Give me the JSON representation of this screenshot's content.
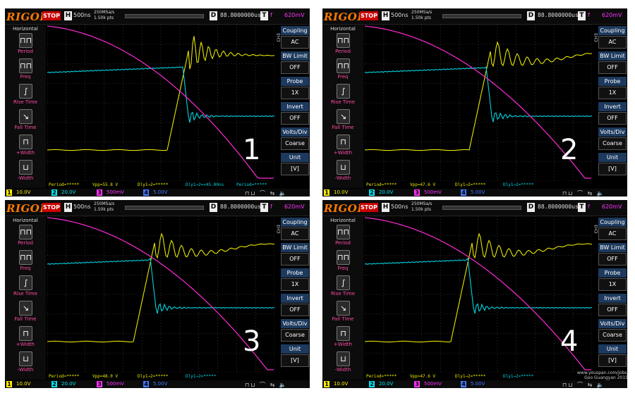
{
  "common": {
    "logo": "RIGOL",
    "run_state": "STOP",
    "h_label": "H",
    "timebase": "500ns",
    "sample_rate": "250MSa/s",
    "points": "1.50k pts",
    "d_label": "D",
    "delay": "88.8000000us",
    "t_label": "T",
    "trigger_source": "f",
    "trigger_level": "620mV",
    "horizontal_title": "Horizontal",
    "channel_tag": "CH3",
    "left_menu": [
      "Period",
      "Freq",
      "Rise Time",
      "Fall Time",
      "+Width",
      "-Width"
    ],
    "right_menu": [
      {
        "head": "Coupling",
        "value": "AC"
      },
      {
        "head": "BW Limit",
        "value": "OFF"
      },
      {
        "head": "Probe",
        "value": "1X"
      },
      {
        "head": "Invert",
        "value": "OFF"
      },
      {
        "head": "Volts/Div",
        "value": "Coarse"
      },
      {
        "head": "Unit",
        "value": "[V]"
      }
    ],
    "channels": [
      {
        "num": "1",
        "value": "10.0V",
        "color": "#ffee00"
      },
      {
        "num": "2",
        "value": "20.0V",
        "color": "#00e5ee"
      },
      {
        "num": "3",
        "value": "500mV",
        "color": "#ff33ff"
      },
      {
        "num": "4",
        "value": "5.00V",
        "color": "#4477ff"
      }
    ],
    "colors": {
      "ch1": "#e6e600",
      "ch2": "#00d4e0",
      "ch3": "#ff2bd6",
      "grid": "#3b3b3b"
    }
  },
  "panels": [
    {
      "number": "1",
      "period": "Period=*****",
      "vpp": "Vpp=55.8 V",
      "dly": "Dly1→2=*****",
      "dly2": "Dly1→2=<45.00ns",
      "period2": "Period=*****"
    },
    {
      "number": "2",
      "period": "Period=*****",
      "vpp": "Vpp=47.6 V",
      "dly": "Dly1→2=*****",
      "dly2": "Dly1→2=*****",
      "period2": ""
    },
    {
      "number": "3",
      "period": "Period=*****",
      "vpp": "Vpp=48.0 V",
      "dly": "Dly1→2=*****",
      "dly2": "Dly1→2=*****",
      "period2": ""
    },
    {
      "number": "4",
      "period": "Period=*****",
      "vpp": "Vpp=47.6 V",
      "dly": "Dly1→2=*****",
      "dly2": "Dly1→2=*****",
      "period2": "",
      "credit": [
        "www.youspan.com/jobs/",
        "Goo Guangyan 2015"
      ]
    }
  ]
}
